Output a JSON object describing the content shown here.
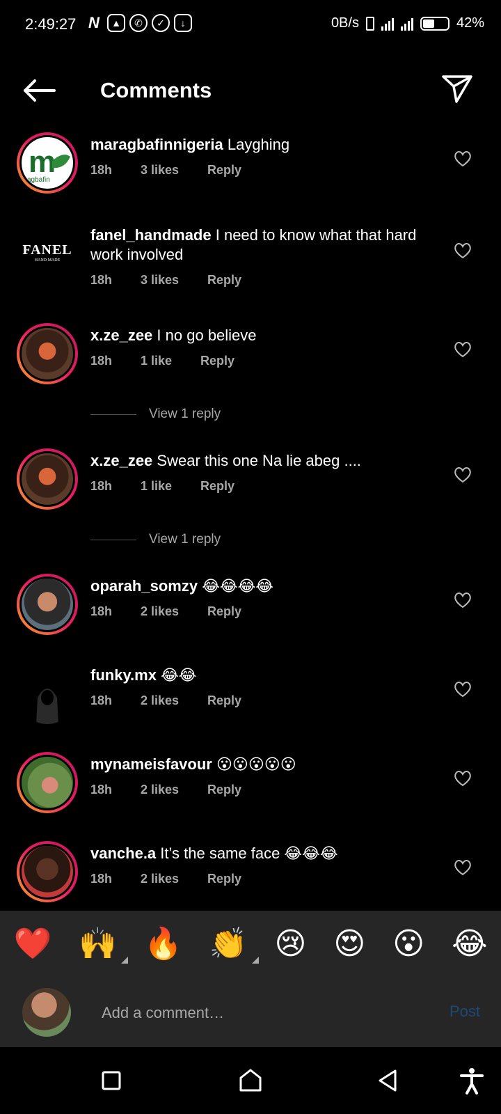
{
  "status_bar": {
    "time": "2:49:27",
    "net_speed": "0B/s",
    "battery": "42%"
  },
  "header": {
    "title": "Comments"
  },
  "comments": [
    {
      "user": "maragbafinnigeria",
      "text": "Layghing",
      "time": "18h",
      "likes": "3 likes",
      "reply": "Reply"
    },
    {
      "user": "fanel_handmade",
      "text": "I need to know what that hard work involved",
      "time": "18h",
      "likes": "3 likes",
      "reply": "Reply"
    },
    {
      "user": "x.ze_zee",
      "text": "I no go believe",
      "time": "18h",
      "likes": "1 like",
      "reply": "Reply",
      "view_replies": "View 1 reply"
    },
    {
      "user": "x.ze_zee",
      "text": "Swear this one Na lie abeg ....",
      "time": "18h",
      "likes": "1 like",
      "reply": "Reply",
      "view_replies": "View 1 reply"
    },
    {
      "user": "oparah_somzy",
      "text": "😂😂😂😂",
      "time": "18h",
      "likes": "2 likes",
      "reply": "Reply"
    },
    {
      "user": "funky.mx",
      "text": "😂😂",
      "time": "18h",
      "likes": "2 likes",
      "reply": "Reply"
    },
    {
      "user": "mynameisfavour",
      "text": "😮😮😮😮😮",
      "time": "18h",
      "likes": "2 likes",
      "reply": "Reply"
    },
    {
      "user": "vanche.a",
      "text": "It’s the same face 😂😂😂",
      "time": "18h",
      "likes": "2 likes",
      "reply": "Reply"
    }
  ],
  "avatar_text": {
    "maragbafin_logo": "m",
    "maragbafin_sub": "agbafin",
    "fanel_logo": "FANEL",
    "fanel_sub": "HAND MADE"
  },
  "emoji_bar": [
    "❤️",
    "🙌",
    "🔥",
    "👏",
    "😢",
    "😍",
    "😮",
    "😂"
  ],
  "comment_box": {
    "placeholder": "Add a comment…",
    "post_label": "Post"
  },
  "colors": {
    "background": "#000000",
    "muted_text": "#a8a8a8",
    "post_disabled": "#1c4a77",
    "bar_background": "#262626"
  }
}
